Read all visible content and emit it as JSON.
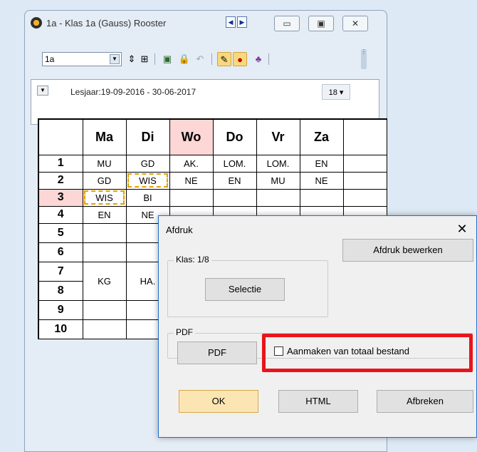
{
  "window": {
    "title": "1a - Klas 1a (Gauss)  Rooster",
    "nav_prev": "◀",
    "nav_next": "▶",
    "minimize": "▭",
    "maximize": "▣",
    "close": "✕"
  },
  "toolbar": {
    "class_select_value": "1a",
    "icons": [
      "spin-icon",
      "grid-icon",
      "export-icon",
      "lock-icon",
      "undo-icon",
      "palette-icon",
      "search-icon",
      "tree-icon"
    ]
  },
  "info": {
    "school_year": "Lesjaar:19-09-2016 - 30-06-2017",
    "calendar_label": "18"
  },
  "schedule": {
    "days": [
      "Ma",
      "Di",
      "Wo",
      "Do",
      "Vr",
      "Za"
    ],
    "highlight_day": "Wo",
    "rows": [
      {
        "n": "1",
        "cells": [
          "MU",
          "GD",
          "AK.",
          "LOM.",
          "LOM.",
          "EN"
        ]
      },
      {
        "n": "2",
        "cells": [
          "GD",
          "WIS",
          "NE",
          "EN",
          "MU",
          "NE"
        ]
      },
      {
        "n": "3",
        "cells": [
          "WIS",
          "BI",
          "",
          "",
          "",
          ""
        ]
      },
      {
        "n": "4",
        "cells": [
          "EN",
          "NE",
          "",
          "",
          "",
          ""
        ]
      },
      {
        "n": "5",
        "cells": [
          "",
          "",
          "",
          "",
          "",
          ""
        ]
      },
      {
        "n": "6",
        "cells": [
          "",
          "",
          "",
          "",
          "",
          ""
        ]
      },
      {
        "n": "7",
        "cells": [
          "KG",
          "HA.",
          "",
          "",
          "",
          ""
        ]
      },
      {
        "n": "8",
        "cells": [
          "",
          "",
          "",
          "",
          "",
          ""
        ]
      },
      {
        "n": "9",
        "cells": [
          "",
          "",
          "",
          "",
          "",
          ""
        ]
      },
      {
        "n": "10",
        "cells": [
          "",
          "",
          "",
          "",
          "",
          ""
        ]
      }
    ]
  },
  "dialog": {
    "title": "Afdruk",
    "close": "✕",
    "klas_group_label": "Klas: 1/8",
    "selectie_button": "Selectie",
    "afdruk_bewerken_button": "Afdruk bewerken",
    "pdf_group_label": "PDF",
    "pdf_button": "PDF",
    "checkbox_label": "Aanmaken van totaal bestand",
    "checkbox_checked": false,
    "ok_button": "OK",
    "html_button": "HTML",
    "afbreken_button": "Afbreken"
  },
  "colors": {
    "highlight": "#fdd6d6",
    "selection_border": "#e0a200",
    "annotation_frame": "#e8141b",
    "default_button": "#fbe6b3"
  }
}
